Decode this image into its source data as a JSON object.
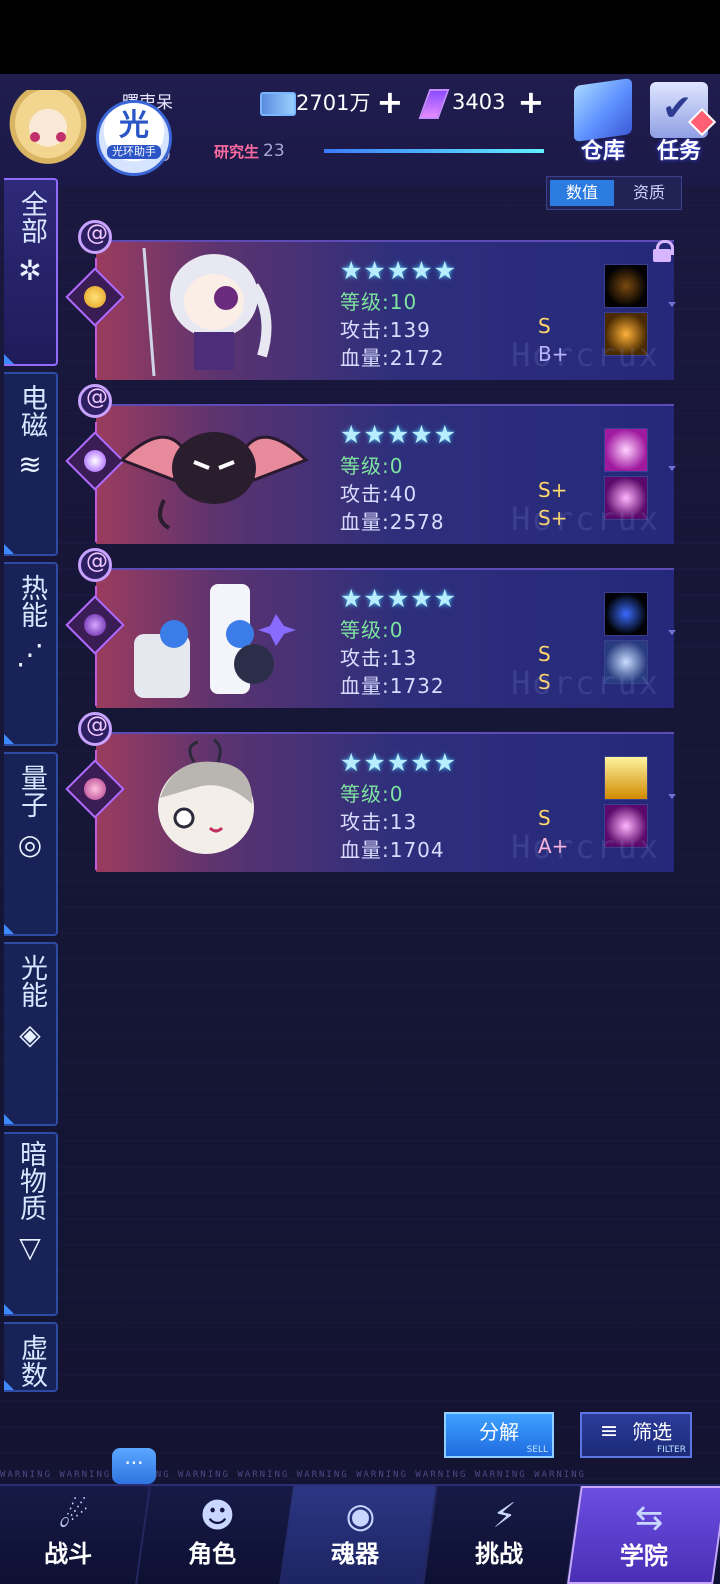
{
  "header": {
    "player_name": "曙吏呆",
    "player_level": "9",
    "badge_big": "光",
    "badge_small": "光环助手",
    "coins": "2701万",
    "gems": "3403",
    "plus": "+",
    "rank_label": "研究生",
    "rank_value": "23",
    "rank_progress": 1.0,
    "warehouse_label": "仓库",
    "tasks_label": "任务"
  },
  "view_toggle": {
    "values": "数值",
    "quality": "资质",
    "selected": "数值"
  },
  "categories": [
    {
      "label": "全部",
      "icon": "flower-icon",
      "icon_glyph": "✲",
      "active": true
    },
    {
      "label": "电磁",
      "icon": "wifi-icon",
      "icon_glyph": "≋"
    },
    {
      "label": "热能",
      "icon": "heat-waves-icon",
      "icon_glyph": "⋰"
    },
    {
      "label": "量子",
      "icon": "quantum-icon",
      "icon_glyph": "◎"
    },
    {
      "label": "光能",
      "icon": "diamond-icon",
      "icon_glyph": "◈"
    },
    {
      "label": "暗物质",
      "icon": "triangle-down-icon",
      "icon_glyph": "▽"
    },
    {
      "label": "虚数",
      "icon": "",
      "icon_glyph": ""
    }
  ],
  "cards": [
    {
      "stars": "★★★★★",
      "level": "等级:10",
      "attack": "攻击:139",
      "hp": "血量:2172",
      "atk_grade": "S",
      "hp_grade": "B+",
      "locked": true,
      "portrait": "white-hair-girl-eyepatch"
    },
    {
      "stars": "★★★★★",
      "level": "等级:0",
      "attack": "攻击:40",
      "hp": "血量:2578",
      "atk_grade": "S+",
      "hp_grade": "S+",
      "locked": false,
      "portrait": "black-bat-creature"
    },
    {
      "stars": "★★★★★",
      "level": "等级:0",
      "attack": "攻击:13",
      "hp": "血量:1732",
      "atk_grade": "S",
      "hp_grade": "S",
      "locked": false,
      "portrait": "white-mech-robot"
    },
    {
      "stars": "★★★★★",
      "level": "等级:0",
      "attack": "攻击:13",
      "hp": "血量:1704",
      "atk_grade": "S",
      "hp_grade": "A+",
      "locked": false,
      "portrait": "chibi-grey-hair-head"
    }
  ],
  "card_watermark": "Horcrux",
  "actions": {
    "decompose": "分解",
    "decompose_sub": "SELL",
    "filter": "筛选",
    "filter_sub": "FILTER"
  },
  "chat_icon": "···",
  "warning_text": "WARNING  WARNING  WARNING  WARNING  WARNING  WARNING  WARNING  WARNING  WARNING  WARNING",
  "nav": [
    {
      "label": "战斗",
      "icon": "battle-icon",
      "glyph": "☄"
    },
    {
      "label": "角色",
      "icon": "characters-icon",
      "glyph": "☻"
    },
    {
      "label": "魂器",
      "icon": "soul-vessel-icon",
      "glyph": "◉"
    },
    {
      "label": "挑战",
      "icon": "challenge-icon",
      "glyph": "⚡"
    },
    {
      "label": "学院",
      "icon": "academy-icon",
      "glyph": "⇆"
    }
  ],
  "colors": {
    "accent": "#2b7be0",
    "grade_gold": "#ffd96b",
    "level_green": "#7fe3a0",
    "nav_active": "#6c4ee2"
  }
}
